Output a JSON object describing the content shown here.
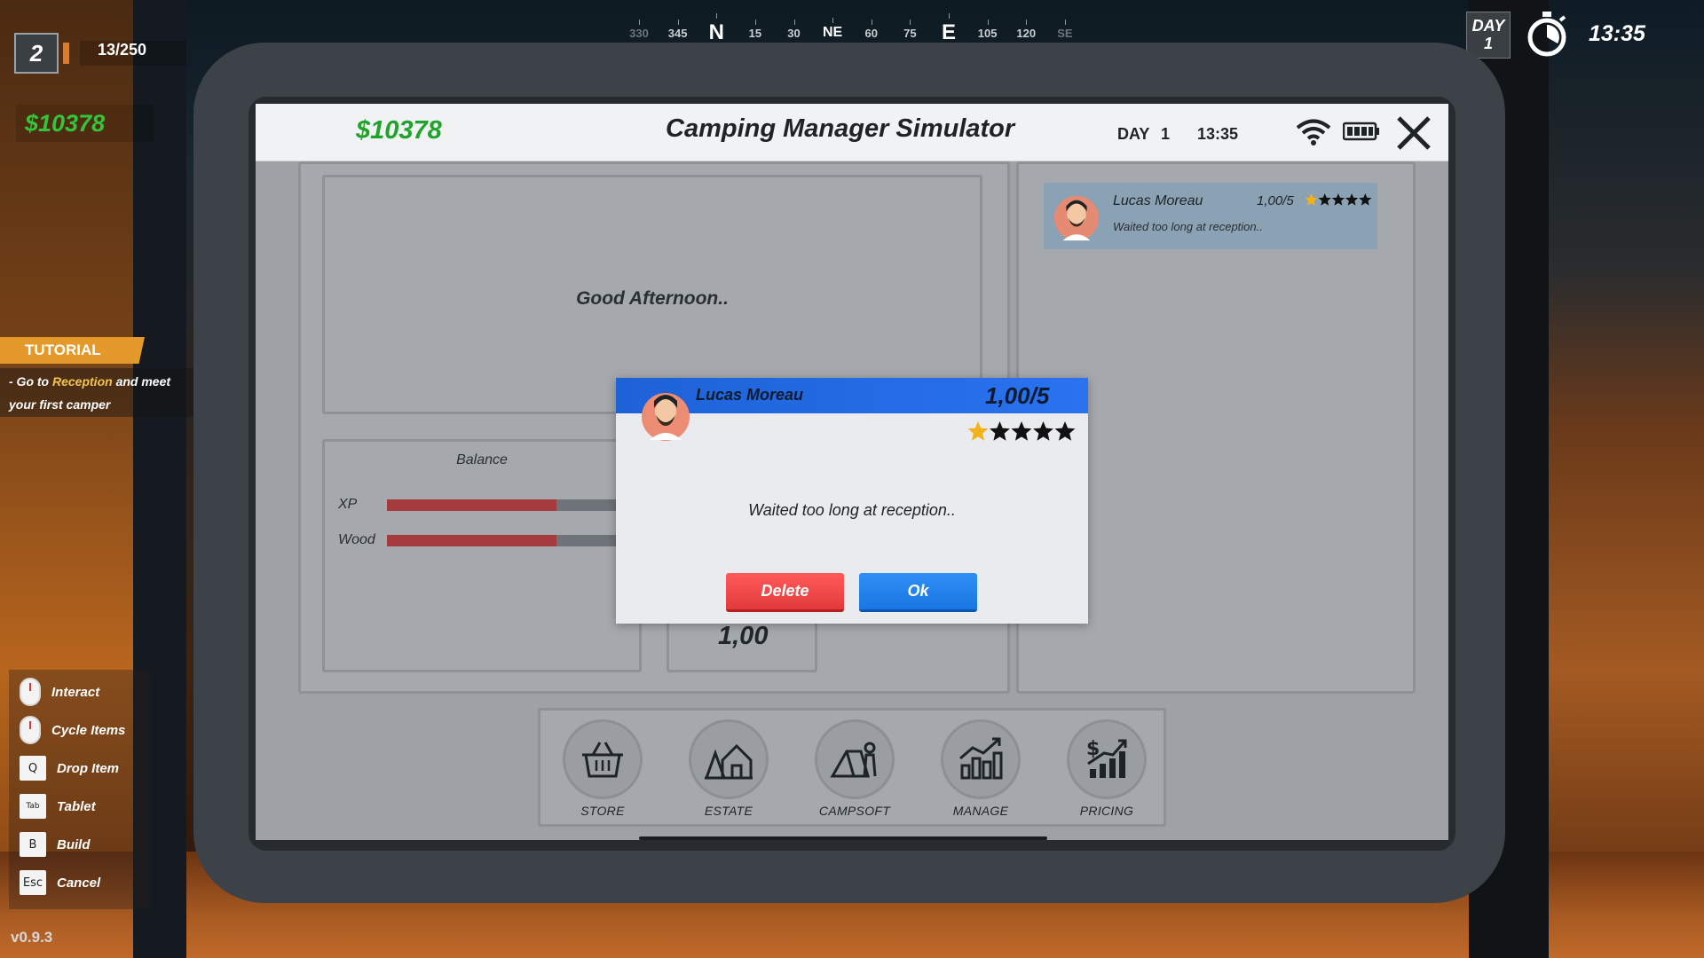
{
  "compass": {
    "ticks": [
      "330",
      "345",
      "N",
      "15",
      "30",
      "NE",
      "60",
      "75",
      "E",
      "105",
      "120",
      "SE"
    ]
  },
  "hud": {
    "level": "2",
    "xp_count": "13/250",
    "money": "$10378",
    "day_label": "DAY",
    "day_number": "1",
    "time": "13:35",
    "version": "v0.9.3"
  },
  "tutorial": {
    "header": "TUTORIAL",
    "line_prefix": "- Go to ",
    "line_highlight": "Reception",
    "line_suffix": " and meet your first camper"
  },
  "controls": [
    {
      "key": "",
      "icon": "mouse-left-icon",
      "label": "Interact"
    },
    {
      "key": "",
      "icon": "mouse-scroll-icon",
      "label": "Cycle Items"
    },
    {
      "key": "Q",
      "icon": "key",
      "label": "Drop Item"
    },
    {
      "key": "Tab",
      "icon": "key",
      "label": "Tablet"
    },
    {
      "key": "B",
      "icon": "key",
      "label": "Build"
    },
    {
      "key": "Esc",
      "icon": "key",
      "label": "Cancel"
    }
  ],
  "tablet": {
    "money": "$10378",
    "title": "Camping Manager Simulator",
    "day_label": "DAY",
    "day_number": "1",
    "time": "13:35",
    "greeting": "Good Afternoon..",
    "balance_title": "Balance",
    "stats": [
      {
        "label": "XP",
        "fill": 0.66
      },
      {
        "label": "Wood",
        "fill": 0.66
      }
    ],
    "rating_value": "1,00",
    "notification": {
      "name": "Lucas Moreau",
      "score": "1,00/5",
      "stars_filled": 1,
      "stars_total": 5,
      "message": "Waited too long at reception.."
    },
    "dock": [
      {
        "label": "STORE",
        "icon": "basket-icon"
      },
      {
        "label": "ESTATE",
        "icon": "house-icon"
      },
      {
        "label": "CAMPSOFT",
        "icon": "tent-icon"
      },
      {
        "label": "MANAGE",
        "icon": "chart-icon"
      },
      {
        "label": "PRICING",
        "icon": "pricing-icon"
      }
    ]
  },
  "dialog": {
    "name": "Lucas Moreau",
    "score": "1,00/5",
    "stars_filled": 1,
    "stars_total": 5,
    "message": "Waited too long at reception..",
    "delete_label": "Delete",
    "ok_label": "Ok"
  },
  "colors": {
    "money_green": "#1fa32a",
    "accent_blue": "#2a72f0",
    "delete_red": "#e23a3a",
    "tutorial_orange": "#e39a2a",
    "star_gold": "#f2b21c"
  }
}
